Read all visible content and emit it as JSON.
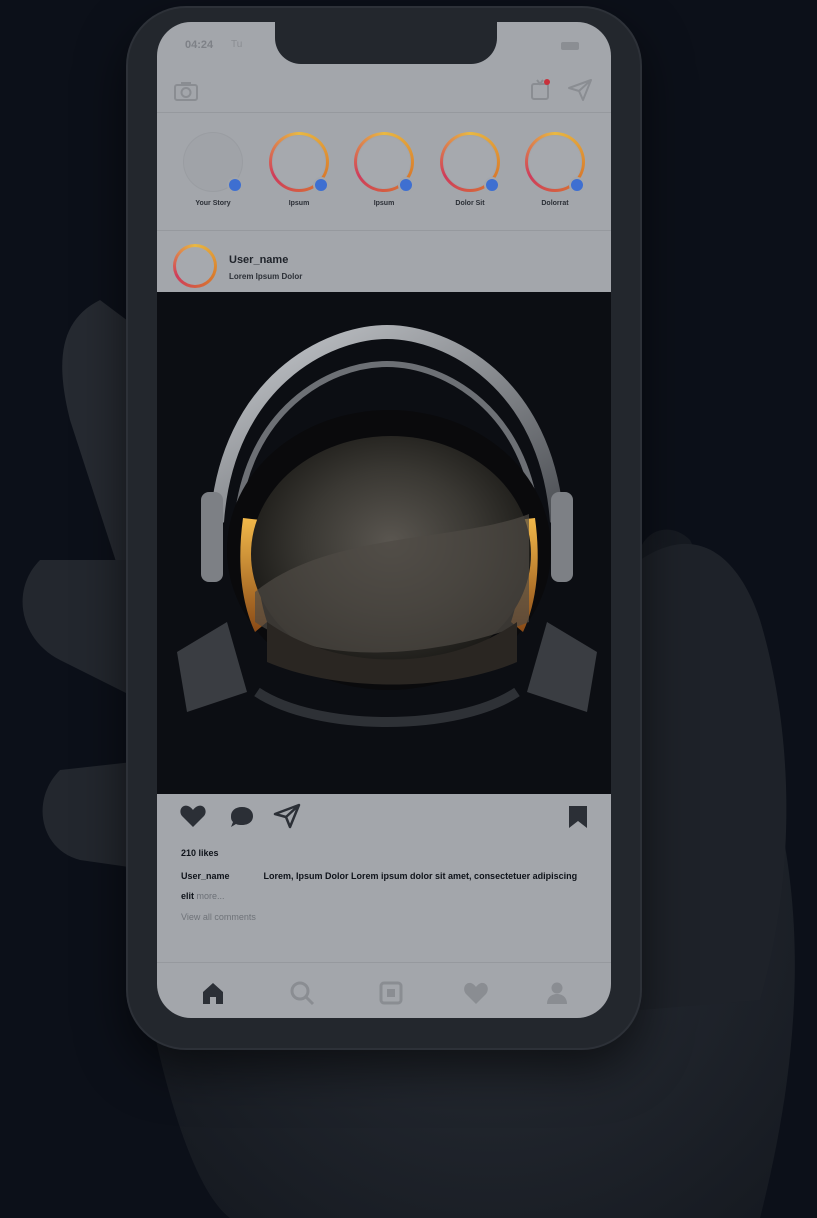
{
  "status_bar": {
    "time": "04:24",
    "carrier": "Tu"
  },
  "stories": [
    {
      "label": "Your Story",
      "is_own": true
    },
    {
      "label": "Ipsum",
      "is_own": false
    },
    {
      "label": "Ipsum",
      "is_own": false
    },
    {
      "label": "Dolor Sit",
      "is_own": false
    },
    {
      "label": "Dolorrat",
      "is_own": false
    }
  ],
  "post": {
    "username": "User_name",
    "location": "Lorem Ipsum Dolor",
    "likes": "210 likes",
    "caption_user": "User_name",
    "caption_text": "Lorem, Ipsum Dolor Lorem ipsum dolor sit amet, consectetuer adipiscing elit",
    "more_label": "more...",
    "view_comments": "View all comments"
  },
  "bottom_nav": [
    "home-icon",
    "search-icon",
    "add-post-icon",
    "heart-icon",
    "profile-icon"
  ],
  "colors": {
    "background": "#0c1019",
    "screen": "#a3a6ab",
    "story_ring": "#e8b842",
    "story_add": "#3e6fd1",
    "notification": "#c8313b"
  }
}
